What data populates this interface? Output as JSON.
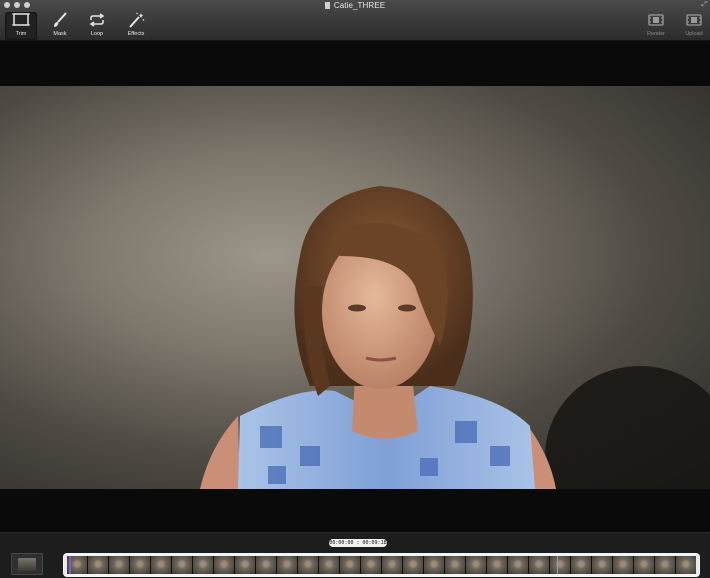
{
  "window": {
    "title": "Catie_THREE",
    "fullscreen_glyph": "⤢"
  },
  "toolbar": {
    "left_tools": [
      {
        "label": "Trim",
        "icon": "trim-frame-icon",
        "active": true
      },
      {
        "label": "Mask",
        "icon": "brush-icon",
        "active": false
      },
      {
        "label": "Loop",
        "icon": "loop-arrows-icon",
        "active": false
      },
      {
        "label": "Effects",
        "icon": "magic-wand-icon",
        "active": false
      }
    ],
    "right_tools": [
      {
        "label": "Render",
        "icon": "film-render-icon",
        "enabled": false
      },
      {
        "label": "Upload",
        "icon": "film-upload-icon",
        "enabled": false
      }
    ]
  },
  "timeline": {
    "timecode": "00:00:00 : 00:09:18",
    "frame_count": 30,
    "playhead_fraction": 0.0,
    "accent": "#7f5acb"
  },
  "colors": {
    "toolbar_top": "#4a4a4a",
    "toolbar_bottom": "#2c2c2c",
    "letterbox": "#0a0a0a"
  }
}
